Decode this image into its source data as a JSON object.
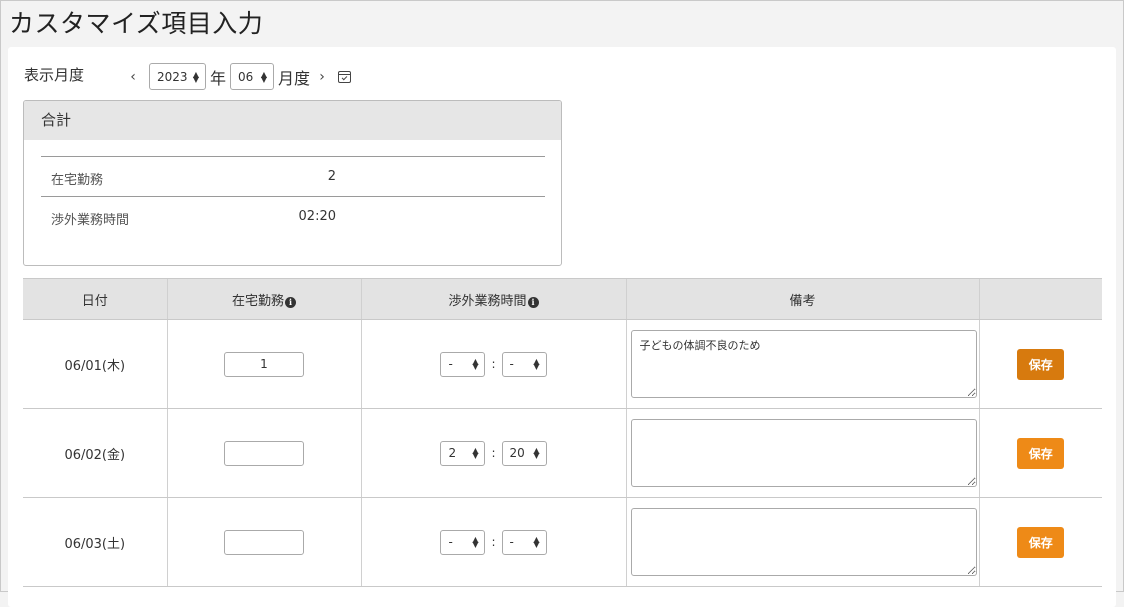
{
  "page": {
    "title": "カスタマイズ項目入力"
  },
  "period": {
    "label": "表示月度",
    "prev": "‹",
    "next": "›",
    "year": "2023",
    "year_unit": "年",
    "month": "06",
    "month_unit": "月度",
    "calendar_icon": "calendar-check-icon"
  },
  "summary": {
    "title": "合計",
    "rows": [
      {
        "label": "在宅勤務",
        "value": "2"
      },
      {
        "label": "渉外業務時間",
        "value": "02:20"
      }
    ]
  },
  "table": {
    "headers": [
      "日付",
      "在宅勤務",
      "渉外業務時間",
      "備考",
      ""
    ],
    "info_icon": "info-circle-icon",
    "rows": [
      {
        "date": "06/01(木)",
        "home": "1",
        "hours": "-",
        "minutes": "-",
        "note": "子どもの体調不良のため",
        "save": "保存"
      },
      {
        "date": "06/02(金)",
        "home": "",
        "hours": "2",
        "minutes": "20",
        "note": "",
        "save": "保存"
      },
      {
        "date": "06/03(土)",
        "home": "",
        "hours": "-",
        "minutes": "-",
        "note": "",
        "save": "保存"
      }
    ]
  },
  "colors": {
    "accent": "#ee8a17",
    "accent_active": "#d77a0e",
    "header_bg": "#e3e3e3"
  }
}
